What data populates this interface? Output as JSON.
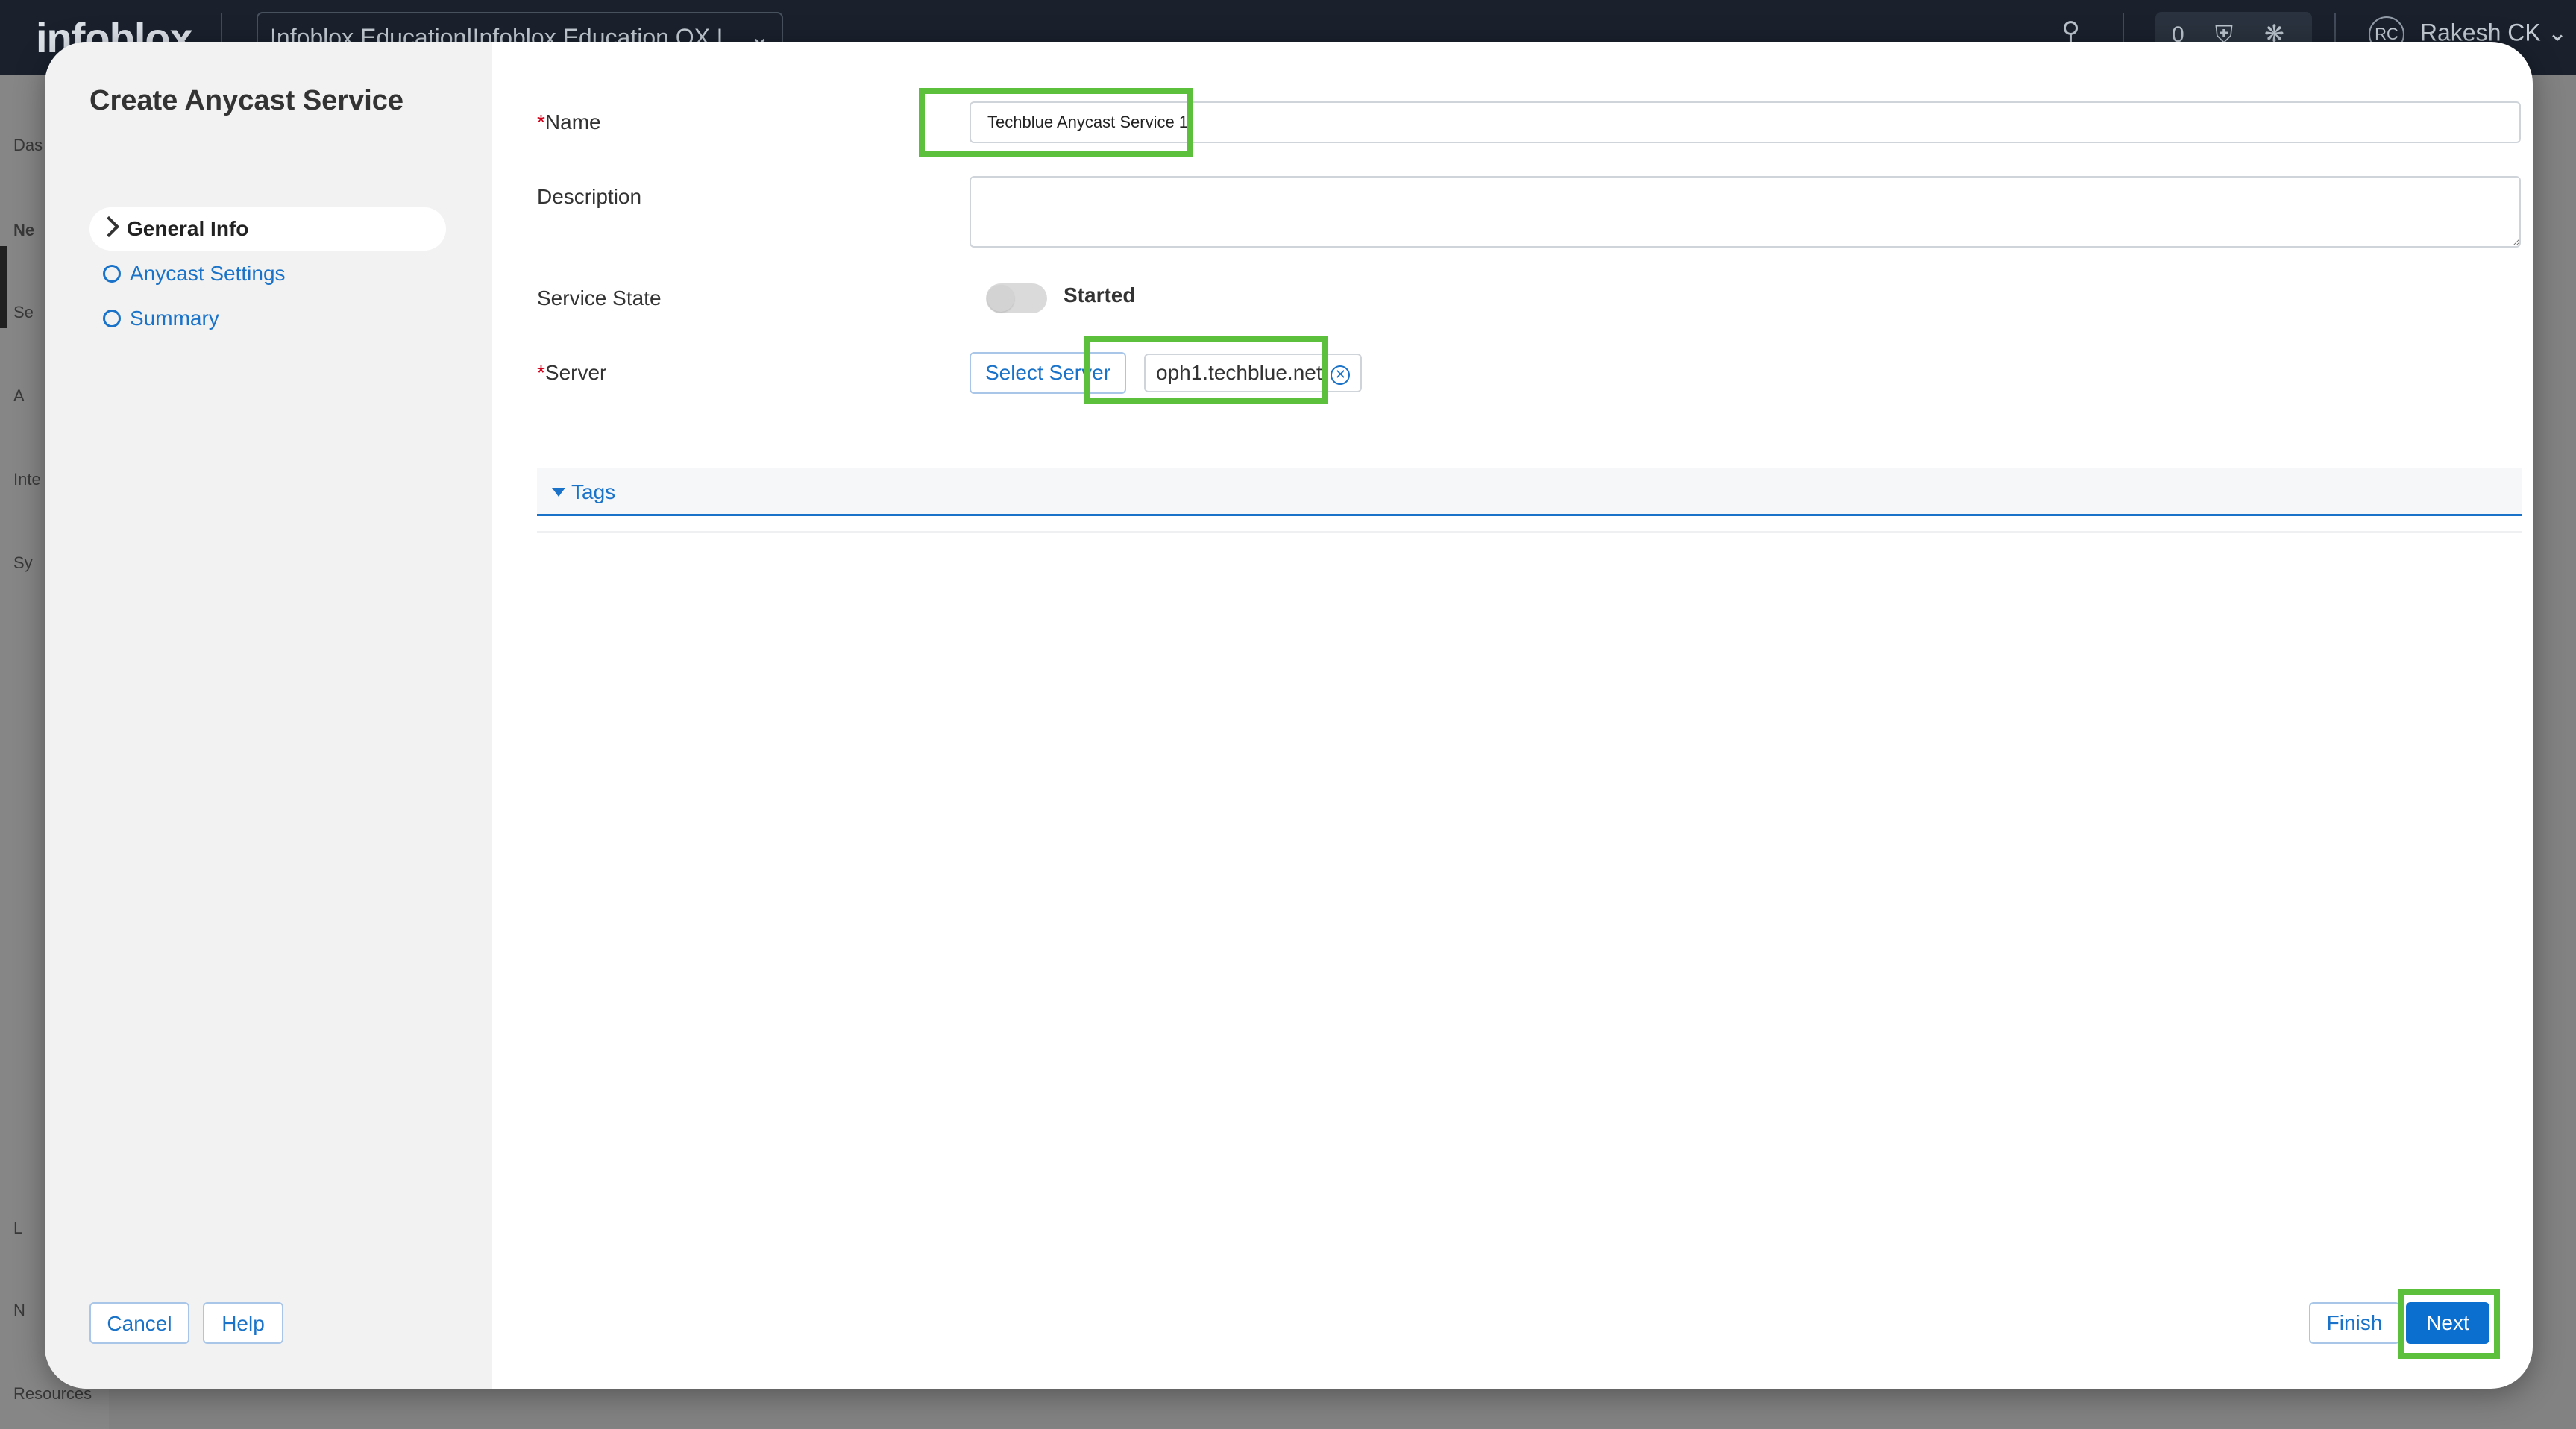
{
  "background": {
    "logo": "infoblox",
    "tenant": "Infoblox Education|Infoblox Education OX L",
    "notification_count": "0",
    "user_initials": "RC",
    "user_name": "Rakesh CK",
    "nav_labels": [
      "Das",
      "Ne",
      "Se",
      "A",
      "Inte",
      "Sy",
      "L",
      "N",
      "Resources"
    ]
  },
  "modal": {
    "title": "Create Anycast Service",
    "steps": [
      {
        "label": "General Info",
        "state": "active"
      },
      {
        "label": "Anycast Settings",
        "state": "todo"
      },
      {
        "label": "Summary",
        "state": "todo"
      }
    ],
    "cancel_label": "Cancel",
    "help_label": "Help",
    "finish_label": "Finish",
    "next_label": "Next"
  },
  "form": {
    "name_label": "Name",
    "name_value": "Techblue Anycast Service 1",
    "description_label": "Description",
    "description_value": "",
    "service_state_label": "Service State",
    "service_state_value": "Started",
    "server_label": "Server",
    "select_server_label": "Select Server",
    "server_chip": "oph1.techblue.net",
    "tags_label": "Tags",
    "required_marker": "*"
  },
  "colors": {
    "accent": "#1a73c8",
    "primary_button": "#0b6fd0",
    "highlight": "#5cc03c",
    "topbar": "#1c2330"
  }
}
